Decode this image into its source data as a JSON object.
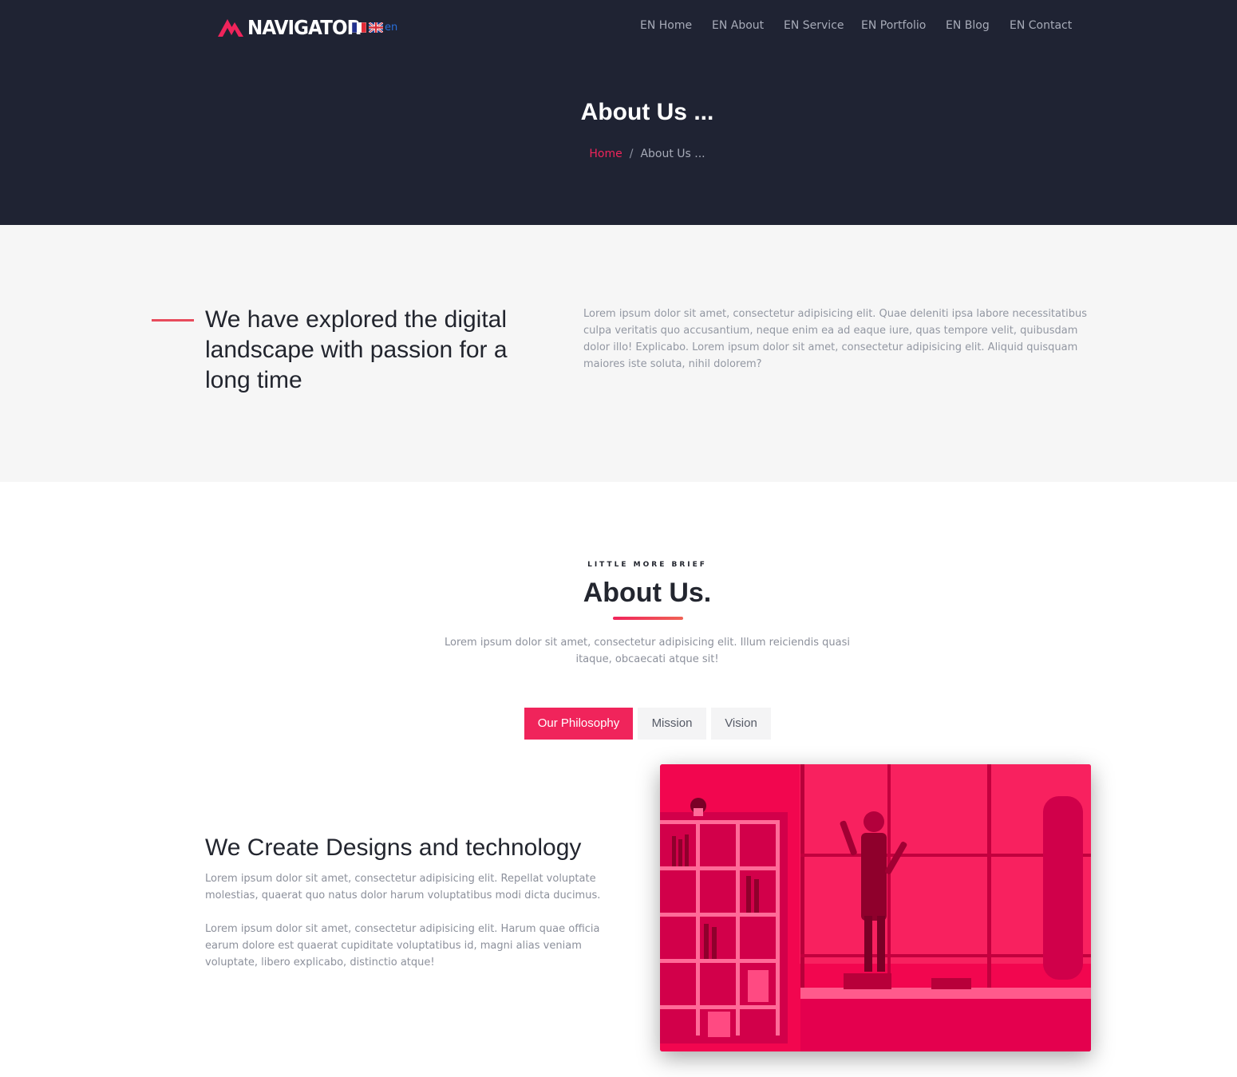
{
  "brand": {
    "name": "NAVIGATOR",
    "accent": "#f0245b",
    "hero_bg": "#1f2333"
  },
  "language": {
    "code": "en",
    "flags": [
      "flag-fr-icon",
      "flag-uk-icon"
    ]
  },
  "nav": [
    {
      "label": "EN Home"
    },
    {
      "label": "EN About"
    },
    {
      "label": "EN Service"
    },
    {
      "label": "EN Portfolio"
    },
    {
      "label": "EN Blog"
    },
    {
      "label": "EN Contact"
    }
  ],
  "hero": {
    "title": "About Us ...",
    "breadcrumb": {
      "home": "Home",
      "separator": "/",
      "current": "About Us ..."
    }
  },
  "intro": {
    "heading": "We have explored the digital landscape with passion for a long time",
    "text": "Lorem ipsum dolor sit amet, consectetur adipisicing elit. Quae deleniti ipsa labore necessitatibus culpa veritatis quo accusantium, neque enim ea ad eaque iure, quas tempore velit, quibusdam dolor illo! Explicabo. Lorem ipsum dolor sit amet, consectetur adipisicing elit. Aliquid quisquam maiores iste soluta, nihil dolorem?"
  },
  "about": {
    "tagline": "LITTLE MORE BRIEF",
    "title": "About Us.",
    "description": "Lorem ipsum dolor sit amet, consectetur adipisicing elit. Illum reiciendis quasi itaque, obcaecati atque sit!"
  },
  "tabs": [
    {
      "label": "Our Philosophy",
      "active": true
    },
    {
      "label": "Mission",
      "active": false
    },
    {
      "label": "Vision",
      "active": false
    }
  ],
  "content": {
    "title": "We Create Designs and technology",
    "paragraphs": [
      "Lorem ipsum dolor sit amet, consectetur adipisicing elit. Repellat voluptate molestias, quaerat quo natus dolor harum voluptatibus modi dicta ducimus.",
      "Lorem ipsum dolor sit amet, consectetur adipisicing elit. Harum quae officia earum dolore est quaerat cupiditate voluptatibus id, magni alias veniam voluptate, libero explicabo, distinctio atque!"
    ]
  }
}
